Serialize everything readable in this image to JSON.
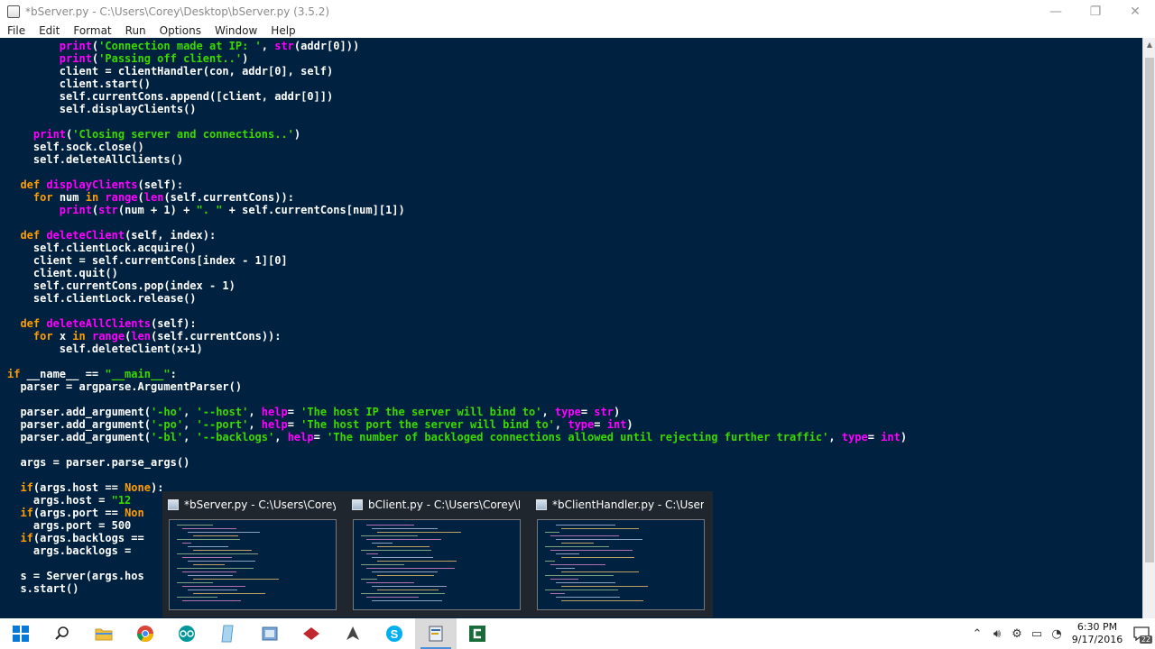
{
  "window": {
    "title": "*bServer.py - C:\\Users\\Corey\\Desktop\\bServer.py (3.5.2)",
    "minimize_glyph": "—",
    "maximize_glyph": "❐",
    "close_glyph": "✕"
  },
  "menu": [
    "File",
    "Edit",
    "Format",
    "Run",
    "Options",
    "Window",
    "Help"
  ],
  "code_lines": [
    [
      [
        "        ",
        ""
      ],
      [
        "print",
        "bi"
      ],
      [
        "(",
        ""
      ],
      [
        "'Connection made at IP: '",
        "st"
      ],
      [
        ", ",
        ""
      ],
      [
        "str",
        "bi"
      ],
      [
        "(addr[0]))",
        ""
      ]
    ],
    [
      [
        "        ",
        ""
      ],
      [
        "print",
        "bi"
      ],
      [
        "(",
        ""
      ],
      [
        "'Passing off client..'",
        "st"
      ],
      [
        ")",
        ""
      ]
    ],
    [
      [
        "        client = clientHandler(con, addr[0], self)",
        ""
      ]
    ],
    [
      [
        "        client.start()",
        ""
      ]
    ],
    [
      [
        "        self.currentCons.append([client, addr[0]])",
        ""
      ]
    ],
    [
      [
        "        self.displayClients()",
        ""
      ]
    ],
    [
      [
        "",
        ""
      ]
    ],
    [
      [
        "    ",
        ""
      ],
      [
        "print",
        "bi"
      ],
      [
        "(",
        ""
      ],
      [
        "'Closing server and connections..'",
        "st"
      ],
      [
        ")",
        ""
      ]
    ],
    [
      [
        "    self.sock.close()",
        ""
      ]
    ],
    [
      [
        "    self.deleteAllClients()",
        ""
      ]
    ],
    [
      [
        "",
        ""
      ]
    ],
    [
      [
        "  ",
        ""
      ],
      [
        "def",
        "kw"
      ],
      [
        " ",
        ""
      ],
      [
        "displayClients",
        "df"
      ],
      [
        "(self):",
        ""
      ]
    ],
    [
      [
        "    ",
        ""
      ],
      [
        "for",
        "kw"
      ],
      [
        " num ",
        ""
      ],
      [
        "in",
        "kw"
      ],
      [
        " ",
        ""
      ],
      [
        "range",
        "bi"
      ],
      [
        "(",
        ""
      ],
      [
        "len",
        "bi"
      ],
      [
        "(self.currentCons)):",
        ""
      ]
    ],
    [
      [
        "        ",
        ""
      ],
      [
        "print",
        "bi"
      ],
      [
        "(",
        ""
      ],
      [
        "str",
        "bi"
      ],
      [
        "(num + 1) + ",
        ""
      ],
      [
        "\". \"",
        "st"
      ],
      [
        " + self.currentCons[num][1])",
        ""
      ]
    ],
    [
      [
        "",
        ""
      ]
    ],
    [
      [
        "  ",
        ""
      ],
      [
        "def",
        "kw"
      ],
      [
        " ",
        ""
      ],
      [
        "deleteClient",
        "df"
      ],
      [
        "(self, index):",
        ""
      ]
    ],
    [
      [
        "    self.clientLock.acquire()",
        ""
      ]
    ],
    [
      [
        "    client = self.currentCons[index - 1][0]",
        ""
      ]
    ],
    [
      [
        "    client.quit()",
        ""
      ]
    ],
    [
      [
        "    self.currentCons.pop(index - 1)",
        ""
      ]
    ],
    [
      [
        "    self.clientLock.release()",
        ""
      ]
    ],
    [
      [
        "",
        ""
      ]
    ],
    [
      [
        "  ",
        ""
      ],
      [
        "def",
        "kw"
      ],
      [
        " ",
        ""
      ],
      [
        "deleteAllClients",
        "df"
      ],
      [
        "(self):",
        ""
      ]
    ],
    [
      [
        "    ",
        ""
      ],
      [
        "for",
        "kw"
      ],
      [
        " x ",
        ""
      ],
      [
        "in",
        "kw"
      ],
      [
        " ",
        ""
      ],
      [
        "range",
        "bi"
      ],
      [
        "(",
        ""
      ],
      [
        "len",
        "bi"
      ],
      [
        "(self.currentCons)):",
        ""
      ]
    ],
    [
      [
        "        self.deleteClient(x+1)",
        ""
      ]
    ],
    [
      [
        "",
        ""
      ]
    ],
    [
      [
        "if",
        "kw"
      ],
      [
        " __name__ == ",
        ""
      ],
      [
        "\"__main__\"",
        "st"
      ],
      [
        ":",
        ""
      ]
    ],
    [
      [
        "  parser = argparse.ArgumentParser()",
        ""
      ]
    ],
    [
      [
        "",
        ""
      ]
    ],
    [
      [
        "  parser.add_argument(",
        ""
      ],
      [
        "'-ho'",
        "st"
      ],
      [
        ", ",
        ""
      ],
      [
        "'--host'",
        "st"
      ],
      [
        ", ",
        ""
      ],
      [
        "help",
        "bi"
      ],
      [
        "= ",
        ""
      ],
      [
        "'The host IP the server will bind to'",
        "st"
      ],
      [
        ", ",
        ""
      ],
      [
        "type",
        "bi"
      ],
      [
        "= ",
        ""
      ],
      [
        "str",
        "bi"
      ],
      [
        ")",
        ""
      ]
    ],
    [
      [
        "  parser.add_argument(",
        ""
      ],
      [
        "'-po'",
        "st"
      ],
      [
        ", ",
        ""
      ],
      [
        "'--port'",
        "st"
      ],
      [
        ", ",
        ""
      ],
      [
        "help",
        "bi"
      ],
      [
        "= ",
        ""
      ],
      [
        "'The host port the server will bind to'",
        "st"
      ],
      [
        ", ",
        ""
      ],
      [
        "type",
        "bi"
      ],
      [
        "= ",
        ""
      ],
      [
        "int",
        "bi"
      ],
      [
        ")",
        ""
      ]
    ],
    [
      [
        "  parser.add_argument(",
        ""
      ],
      [
        "'-bl'",
        "st"
      ],
      [
        ", ",
        ""
      ],
      [
        "'--backlogs'",
        "st"
      ],
      [
        ", ",
        ""
      ],
      [
        "help",
        "bi"
      ],
      [
        "= ",
        ""
      ],
      [
        "'The number of backloged connections allowed until rejecting further traffic'",
        "st"
      ],
      [
        ", ",
        ""
      ],
      [
        "type",
        "bi"
      ],
      [
        "= ",
        ""
      ],
      [
        "int",
        "bi"
      ],
      [
        ")",
        ""
      ]
    ],
    [
      [
        "",
        ""
      ]
    ],
    [
      [
        "  args = parser.parse_args()",
        ""
      ]
    ],
    [
      [
        "",
        ""
      ]
    ],
    [
      [
        "  ",
        ""
      ],
      [
        "if",
        "kw"
      ],
      [
        "(args.host == ",
        ""
      ],
      [
        "None",
        "kw"
      ],
      [
        "):",
        ""
      ]
    ],
    [
      [
        "    args.host = ",
        ""
      ],
      [
        "\"12",
        "st"
      ]
    ],
    [
      [
        "  ",
        ""
      ],
      [
        "if",
        "kw"
      ],
      [
        "(args.port == ",
        ""
      ],
      [
        "Non",
        "kw"
      ]
    ],
    [
      [
        "    args.port = 500",
        ""
      ]
    ],
    [
      [
        "  ",
        ""
      ],
      [
        "if",
        "kw"
      ],
      [
        "(args.backlogs ==",
        ""
      ]
    ],
    [
      [
        "    args.backlogs =",
        ""
      ]
    ],
    [
      [
        "",
        ""
      ]
    ],
    [
      [
        "  s = Server(args.hos",
        ""
      ]
    ],
    [
      [
        "  s.start()",
        ""
      ]
    ]
  ],
  "previews": [
    {
      "title": "*bServer.py - C:\\Users\\Corey\\D...",
      "active": true
    },
    {
      "title": "bClient.py - C:\\Users\\Corey\\Do...",
      "active": false
    },
    {
      "title": "*bClientHandler.py - C:\\Users\\...",
      "active": false
    }
  ],
  "taskbar": [
    {
      "name": "start",
      "icon": "windows-logo-icon"
    },
    {
      "name": "search",
      "icon": "search-icon"
    },
    {
      "name": "file-explorer",
      "icon": "folder-icon"
    },
    {
      "name": "chrome",
      "icon": "chrome-icon"
    },
    {
      "name": "arduino",
      "icon": "arduino-icon"
    },
    {
      "name": "notepad",
      "icon": "notepad-icon"
    },
    {
      "name": "app",
      "icon": "app-icon"
    },
    {
      "name": "app-red",
      "icon": "red-app-icon"
    },
    {
      "name": "inkscape",
      "icon": "pen-icon"
    },
    {
      "name": "skype",
      "icon": "skype-icon"
    },
    {
      "name": "idle",
      "icon": "python-idle-icon"
    },
    {
      "name": "camtasia",
      "icon": "camtasia-icon"
    }
  ],
  "tray": {
    "time": "6:30 PM",
    "date": "9/17/2016",
    "notifications": "22"
  },
  "colors": {
    "editor_bg": "#002240",
    "keyword": "#ff9d00",
    "builtin": "#ff00ff",
    "string": "#3ad900"
  }
}
